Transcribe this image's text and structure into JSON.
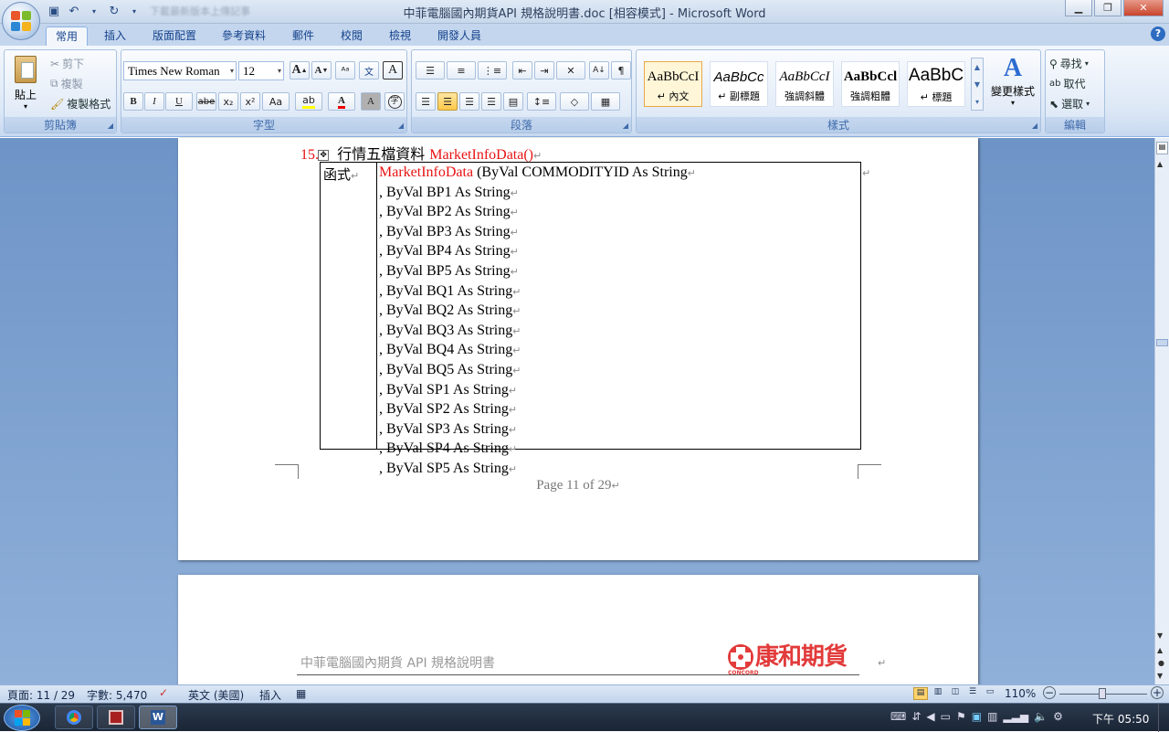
{
  "window": {
    "title": "中菲電腦國內期貨API 規格說明書.doc [相容模式] - Microsoft Word",
    "qat_extra": "下載最新版本上傳記事"
  },
  "tabs": [
    "常用",
    "插入",
    "版面配置",
    "參考資料",
    "郵件",
    "校閱",
    "檢視",
    "開發人員"
  ],
  "clipboard": {
    "paste": "貼上",
    "cut": "剪下",
    "copy": "複製",
    "format_painter": "複製格式",
    "label": "剪貼簿"
  },
  "font": {
    "name": "Times New Roman",
    "size": "12",
    "label": "字型",
    "grow": "A",
    "shrink": "A",
    "bold": "B",
    "italic": "I",
    "underline": "U",
    "strike": "abe",
    "sub": "x₂",
    "sup": "x²",
    "case": "Aa"
  },
  "paragraph": {
    "label": "段落"
  },
  "styles": {
    "label": "樣式",
    "items": [
      {
        "preview": "AaBbCcI",
        "name": "↵ 內文"
      },
      {
        "preview": "AaBbCc",
        "name": "↵ 副標題"
      },
      {
        "preview": "AaBbCcI",
        "name": "強調斜體"
      },
      {
        "preview": "AaBbCcl",
        "name": "強調粗體"
      },
      {
        "preview": "AaBbC",
        "name": "↵ 標題"
      }
    ],
    "change": "變更樣式"
  },
  "editing": {
    "find": "尋找",
    "replace": "取代",
    "select": "選取",
    "label": "編輯"
  },
  "document": {
    "heading_num": "15.",
    "heading_text": "行情五檔資料 ",
    "heading_func": "MarketInfoData()",
    "table_label": "函式",
    "first_line_func": "MarketInfoData",
    "first_line_rest": " (ByVal COMMODITYID As String",
    "params": [
      ", ByVal BP1 As String",
      ", ByVal BP2 As String",
      ", ByVal BP3 As String",
      ", ByVal BP4 As String",
      ", ByVal BP5 As String",
      ", ByVal BQ1 As String",
      ", ByVal BQ2 As String",
      ", ByVal BQ3 As String",
      ", ByVal BQ4 As String",
      ", ByVal BQ5 As String",
      ", ByVal SP1 As String",
      ", ByVal SP2 As String",
      ", ByVal SP3 As String",
      ", ByVal SP4 As String",
      ", ByVal SP5 As String"
    ],
    "footer": "Page 11 of 29",
    "header_next": "中菲電腦國內期貨 API  規格說明書",
    "logo_text": "康和期貨",
    "logo_sub": "CONCORD"
  },
  "status": {
    "page": "頁面: 11 / 29",
    "words": "字數: 5,470",
    "lang": "英文 (美國)",
    "mode": "插入",
    "zoom": "110%"
  },
  "taskbar": {
    "clock": "下午 05:50"
  },
  "colors": {
    "accent": "#15428b",
    "red_text": "#e81313",
    "ribbon": "#dde8f6"
  }
}
